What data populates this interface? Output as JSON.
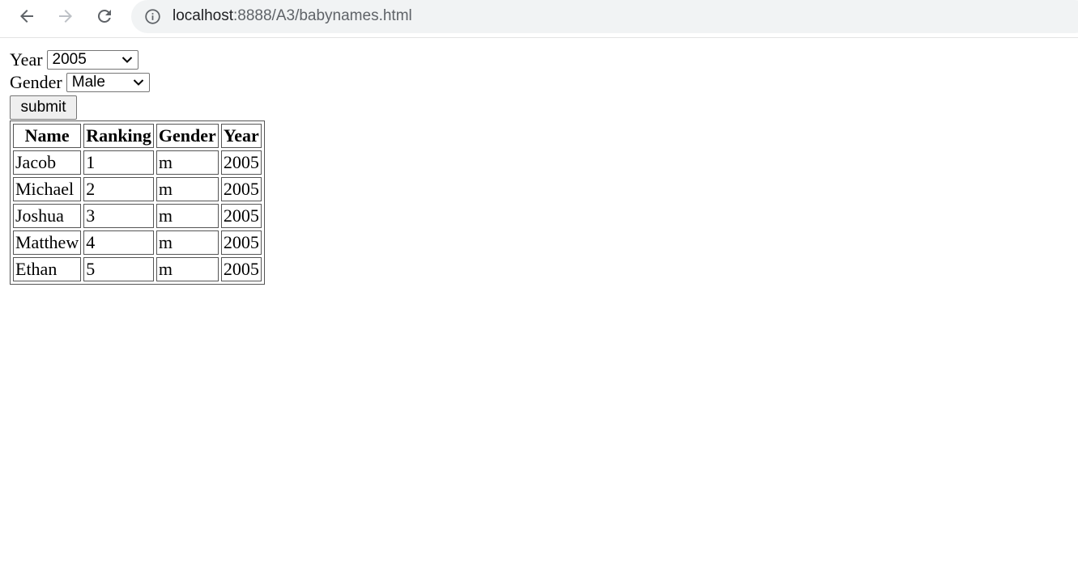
{
  "browser": {
    "url_host": "localhost",
    "url_rest": ":8888/A3/babynames.html"
  },
  "form": {
    "year_label": "Year",
    "year_value": "2005",
    "gender_label": "Gender",
    "gender_value": "Male",
    "submit_label": "submit"
  },
  "table": {
    "headers": [
      "Name",
      "Ranking",
      "Gender",
      "Year"
    ],
    "rows": [
      [
        "Jacob",
        "1",
        "m",
        "2005"
      ],
      [
        "Michael",
        "2",
        "m",
        "2005"
      ],
      [
        "Joshua",
        "3",
        "m",
        "2005"
      ],
      [
        "Matthew",
        "4",
        "m",
        "2005"
      ],
      [
        "Ethan",
        "5",
        "m",
        "2005"
      ]
    ]
  }
}
